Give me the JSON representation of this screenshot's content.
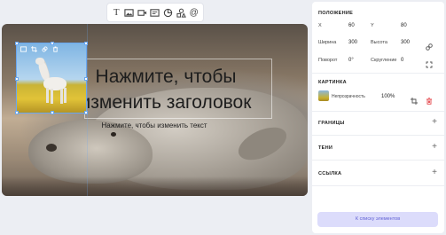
{
  "toolbar": {
    "tools": [
      {
        "name": "text-tool",
        "glyph": "T"
      },
      {
        "name": "image-tool"
      },
      {
        "name": "video-tool"
      },
      {
        "name": "embed-tool"
      },
      {
        "name": "chart-tool"
      },
      {
        "name": "shape-tool"
      },
      {
        "name": "mention-tool",
        "glyph": "@"
      }
    ]
  },
  "slide": {
    "title": "Нажмите, чтобы изменить заголовок",
    "subtitle": "Нажмите, чтобы изменить текст"
  },
  "panel": {
    "position": {
      "title": "ПОЛОЖЕНИЕ",
      "x_label": "X",
      "x_value": "60",
      "y_label": "Y",
      "y_value": "80",
      "width_label": "Ширина",
      "width_value": "300",
      "height_label": "Высота",
      "height_value": "300",
      "rotation_label": "Поворот",
      "rotation_value": "0°",
      "rounding_label": "Скругление",
      "rounding_value": "0"
    },
    "picture": {
      "title": "КАРТИНКА",
      "opacity_label": "Непрозрачность",
      "opacity_value": "100%"
    },
    "borders_title": "ГРАНИЦЫ",
    "shadows_title": "ТЕНИ",
    "link_title": "ССЫЛКА",
    "back_button": "К списку элементов"
  },
  "colors": {
    "accent": "#6aa7f0",
    "delete": "#e5484d",
    "button_bg": "#dcdcfb",
    "button_text": "#5f5fd4"
  }
}
